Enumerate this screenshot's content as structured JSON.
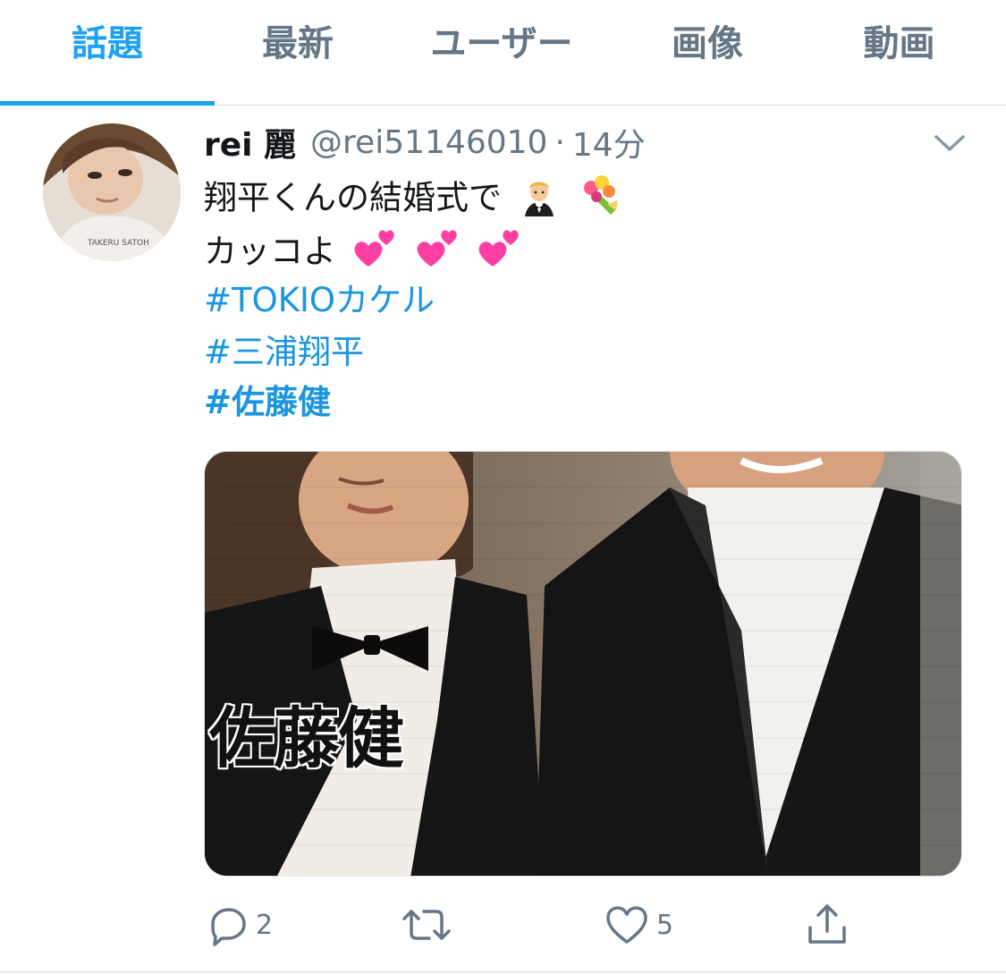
{
  "tabs": [
    {
      "label": "話題",
      "active": true
    },
    {
      "label": "最新",
      "active": false
    },
    {
      "label": "ユーザー",
      "active": false
    },
    {
      "label": "画像",
      "active": false
    },
    {
      "label": "動画",
      "active": false
    }
  ],
  "tweet": {
    "display_name": "rei 麗",
    "handle": "@rei51146010",
    "separator": "·",
    "time": "14分",
    "avatar_shirt_text": "TAKERU SATOH",
    "lines": [
      "翔平くんの結婚式で",
      "カッコよ"
    ],
    "line_emojis": [
      [
        "man-in-tuxedo-emoji",
        "bouquet-emoji"
      ],
      [
        "two-hearts-emoji",
        "two-hearts-emoji",
        "two-hearts-emoji"
      ]
    ],
    "hashtags": [
      "#TOKIOカケル",
      "#三浦翔平",
      "#佐藤健"
    ],
    "media_caption": "佐藤健",
    "reply_count": "2",
    "retweet_count": "",
    "like_count": "5"
  },
  "colors": {
    "accent": "#1da1f2",
    "hashtag": "#1b95e0",
    "secondary_text": "#657786",
    "heart_emoji": "#ff3fa4"
  }
}
